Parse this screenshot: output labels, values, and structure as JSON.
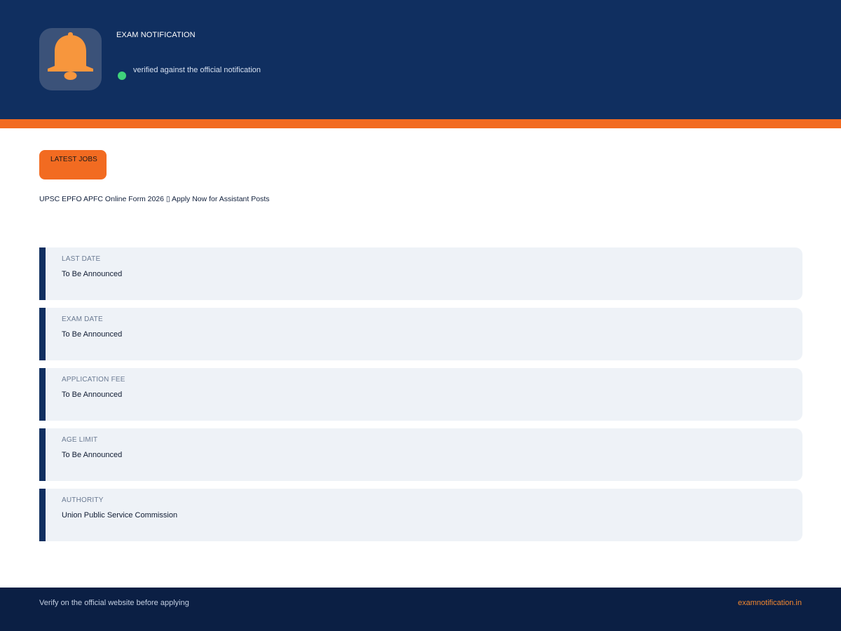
{
  "header": {
    "label": "EXAM NOTIFICATION",
    "verified_text": "verified against the official notification",
    "logo_icon": "bell-icon",
    "colors": {
      "background": "#102f60",
      "accent": "#f26b21",
      "verified": "#3fd27b"
    }
  },
  "category": {
    "label": "LATEST JOBS"
  },
  "post": {
    "title": "UPSC EPFO APFC Online Form 2026 ▯ Apply Now for Assistant Posts"
  },
  "details": [
    {
      "label": "LAST DATE",
      "value": "To Be Announced"
    },
    {
      "label": "EXAM DATE",
      "value": "To Be Announced"
    },
    {
      "label": "APPLICATION FEE",
      "value": "To Be Announced"
    },
    {
      "label": "AGE LIMIT",
      "value": "To Be Announced"
    },
    {
      "label": "AUTHORITY",
      "value": "Union Public Service Commission"
    }
  ],
  "footer": {
    "note": "Verify on the official website before applying",
    "site": "examnotification.in"
  }
}
